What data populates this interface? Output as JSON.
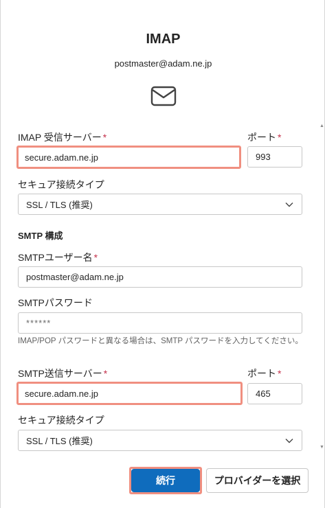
{
  "header": {
    "title": "IMAP",
    "email": "postmaster@adam.ne.jp",
    "icon": "mail-envelope-icon"
  },
  "imap": {
    "server_label": "IMAP 受信サーバー",
    "server_value": "secure.adam.ne.jp",
    "port_label": "ポート",
    "port_value": "993",
    "security_label": "セキュア接続タイプ",
    "security_value": "SSL / TLS (推奨)"
  },
  "smtp": {
    "section_title": "SMTP 構成",
    "username_label": "SMTPユーザー名",
    "username_value": "postmaster@adam.ne.jp",
    "password_label": "SMTPパスワード",
    "password_placeholder": "******",
    "password_hint": "IMAP/POP パスワードと異なる場合は、SMTP パスワードを入力してください。",
    "server_label": "SMTP送信サーバー",
    "server_value": "secure.adam.ne.jp",
    "port_label": "ポート",
    "port_value": "465",
    "security_label": "セキュア接続タイプ",
    "security_value": "SSL / TLS (推奨)"
  },
  "required_marker": "*",
  "buttons": {
    "continue": "続行",
    "choose_provider": "プロバイダーを選択"
  },
  "colors": {
    "primary": "#0f6cbd",
    "highlight": "#f08f80",
    "required": "#c4314b"
  }
}
